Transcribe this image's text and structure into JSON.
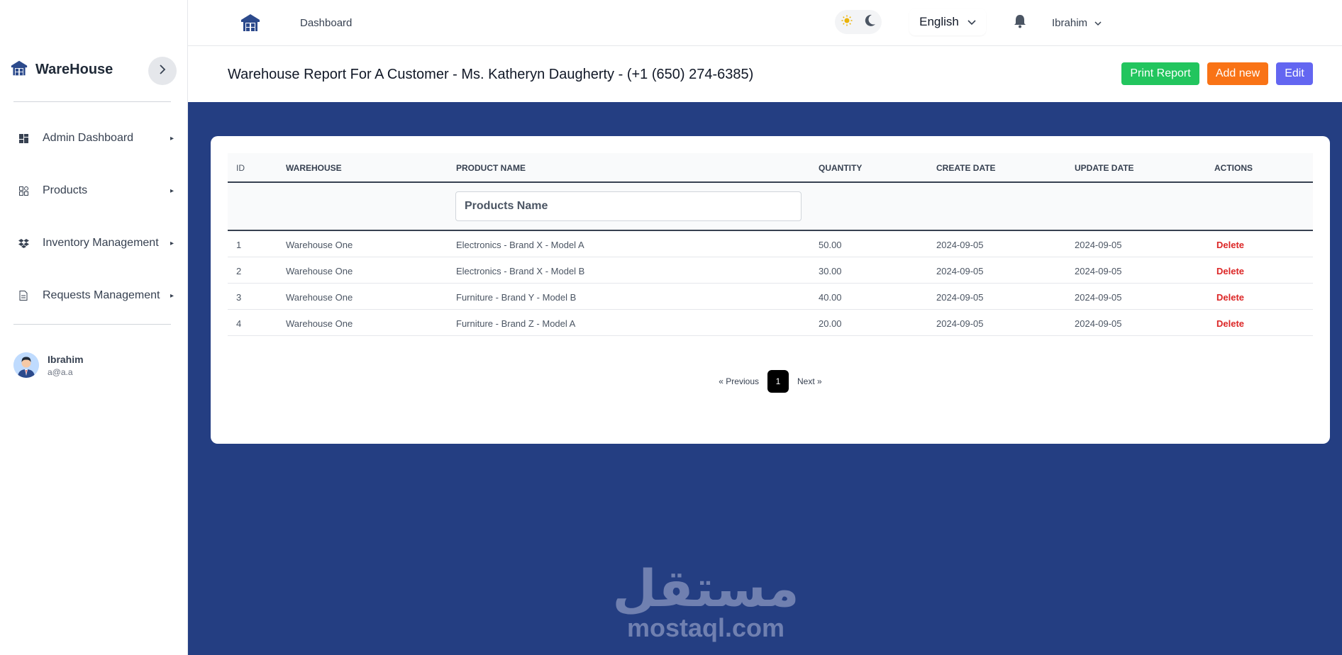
{
  "topbar": {
    "dashboard_link": "Dashboard",
    "language": "English",
    "user": "Ibrahim"
  },
  "sidebar": {
    "brand": "WareHouse",
    "items": [
      {
        "label": "Admin Dashboard",
        "icon": "dashboard-grid-icon"
      },
      {
        "label": "Products",
        "icon": "apps-icon"
      },
      {
        "label": "Inventory Management",
        "icon": "dropbox-icon"
      },
      {
        "label": "Requests Management",
        "icon": "document-icon"
      }
    ],
    "user": {
      "name": "Ibrahim",
      "email": "a@a.a"
    }
  },
  "header": {
    "title": "Warehouse Report For A Customer - Ms. Katheryn Daugherty - (+1 (650) 274-6385)",
    "buttons": {
      "print": "Print Report",
      "add": "Add new",
      "edit": "Edit"
    }
  },
  "table": {
    "columns": [
      "ID",
      "WAREHOUSE",
      "PRODUCT NAME",
      "QUANTITY",
      "CREATE DATE",
      "UPDATE DATE",
      "ACTIONS"
    ],
    "filter_placeholder": "Products Name",
    "rows": [
      {
        "id": "1",
        "warehouse": "Warehouse One",
        "product": "Electronics - Brand X - Model A",
        "quantity": "50.00",
        "created": "2024-09-05",
        "updated": "2024-09-05",
        "action": "Delete"
      },
      {
        "id": "2",
        "warehouse": "Warehouse One",
        "product": "Electronics - Brand X - Model B",
        "quantity": "30.00",
        "created": "2024-09-05",
        "updated": "2024-09-05",
        "action": "Delete"
      },
      {
        "id": "3",
        "warehouse": "Warehouse One",
        "product": "Furniture - Brand Y - Model B",
        "quantity": "40.00",
        "created": "2024-09-05",
        "updated": "2024-09-05",
        "action": "Delete"
      },
      {
        "id": "4",
        "warehouse": "Warehouse One",
        "product": "Furniture - Brand Z - Model A",
        "quantity": "20.00",
        "created": "2024-09-05",
        "updated": "2024-09-05",
        "action": "Delete"
      }
    ]
  },
  "pagination": {
    "previous": "« Previous",
    "current": "1",
    "next": "Next »"
  },
  "watermark": {
    "arabic": "مستقل",
    "latin": "mostaql.com"
  },
  "colors": {
    "primary_blue": "#243e82",
    "print_green": "#22c55e",
    "add_orange": "#f97316",
    "edit_indigo": "#6366f1",
    "delete_red": "#dc2626"
  }
}
